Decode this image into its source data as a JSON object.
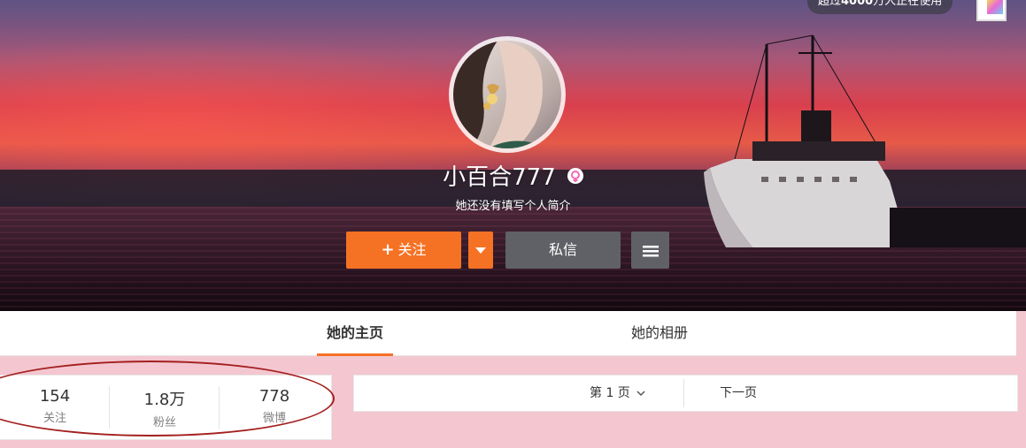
{
  "header": {
    "notice_prefix": "超过",
    "notice_number": "4000",
    "notice_suffix": "万人正在使用"
  },
  "profile": {
    "name": "小百合777",
    "bio": "她还没有填写个人简介",
    "gender_icon": "female-icon"
  },
  "actions": {
    "follow_plus": "+",
    "follow_label": "关注",
    "message_label": "私信"
  },
  "tabs": [
    {
      "label": "她的主页",
      "active": true
    },
    {
      "label": "她的相册",
      "active": false
    }
  ],
  "stats": [
    {
      "value": "154",
      "label": "关注"
    },
    {
      "value": "1.8万",
      "label": "粉丝"
    },
    {
      "value": "778",
      "label": "微博"
    }
  ],
  "pager": {
    "current_page": "第 1 页",
    "next_label": "下一页"
  },
  "colors": {
    "accent": "#f57224",
    "secondary_button": "#5f6166",
    "page_bg": "#f4c6d0",
    "annotation": "#a3201f"
  }
}
